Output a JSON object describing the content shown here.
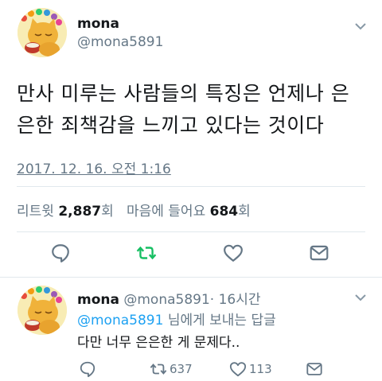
{
  "tweet": {
    "author_name": "mona",
    "author_handle": "@mona5891",
    "text_line1": "만사 미루는 사람들의 특징은 언제나 은",
    "text_line2": "은한 죄책감을 느끼고 있다는 것이다",
    "timestamp": "2017. 12. 16. 오전 1:16",
    "retweets_label": "리트윗",
    "retweets_count": "2,887",
    "retweets_unit": "회",
    "likes_label": "마음에 들어요",
    "likes_count": "684",
    "likes_unit": "회"
  },
  "reply": {
    "author_name": "mona",
    "author_handle": "@mona5891",
    "time_ago": "· 16시간",
    "reply_to_mention": "@mona5891",
    "reply_to_suffix": "님에게 보내는 답글",
    "text": "다만 너무 은은한 게 문제다..",
    "retweet_count": "637",
    "like_count": "113"
  },
  "icons": {
    "reply": "reply-icon",
    "retweet": "retweet-icon",
    "like": "heart-icon",
    "share": "share-icon",
    "menu": "chevron-down-icon"
  },
  "colors": {
    "retweet_accent": "#17bf63",
    "link": "#1da1f2",
    "muted": "#657786"
  }
}
